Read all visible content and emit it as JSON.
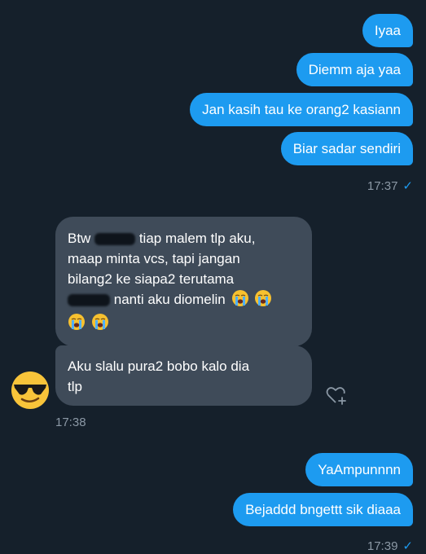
{
  "messages_top": {
    "m1": "Iyaa",
    "m2": "Diemm aja yaa",
    "m3": "Jan kasih tau ke orang2 kasiann",
    "m4": "Biar sadar sendiri",
    "time": "17:37",
    "status": "✓"
  },
  "incoming": {
    "b1_l1_a": "Btw",
    "b1_l1_b": "tiap malem tlp aku,",
    "b1_l2": "maap minta vcs, tapi jangan",
    "b1_l3": "bilang2 ke siapa2 terutama",
    "b1_l4": "nanti aku diomelin",
    "b2_l1": "Aku slalu pura2 bobo kalo dia",
    "b2_l2": "tlp",
    "time": "17:38"
  },
  "messages_bottom": {
    "m1": "YaAmpunnnn",
    "m2": "Bejaddd bngettt sik diaaa",
    "time": "17:39",
    "status": "✓"
  },
  "icons": {
    "avatar": "sunglasses-emoji-avatar",
    "react": "heart-plus-icon",
    "emoji": "loudly-crying-face"
  },
  "colors": {
    "background": "#15202b",
    "outgoing_bubble": "#1d9bf0",
    "incoming_bubble": "#3f4b59",
    "timestamp": "#8b98a5"
  }
}
